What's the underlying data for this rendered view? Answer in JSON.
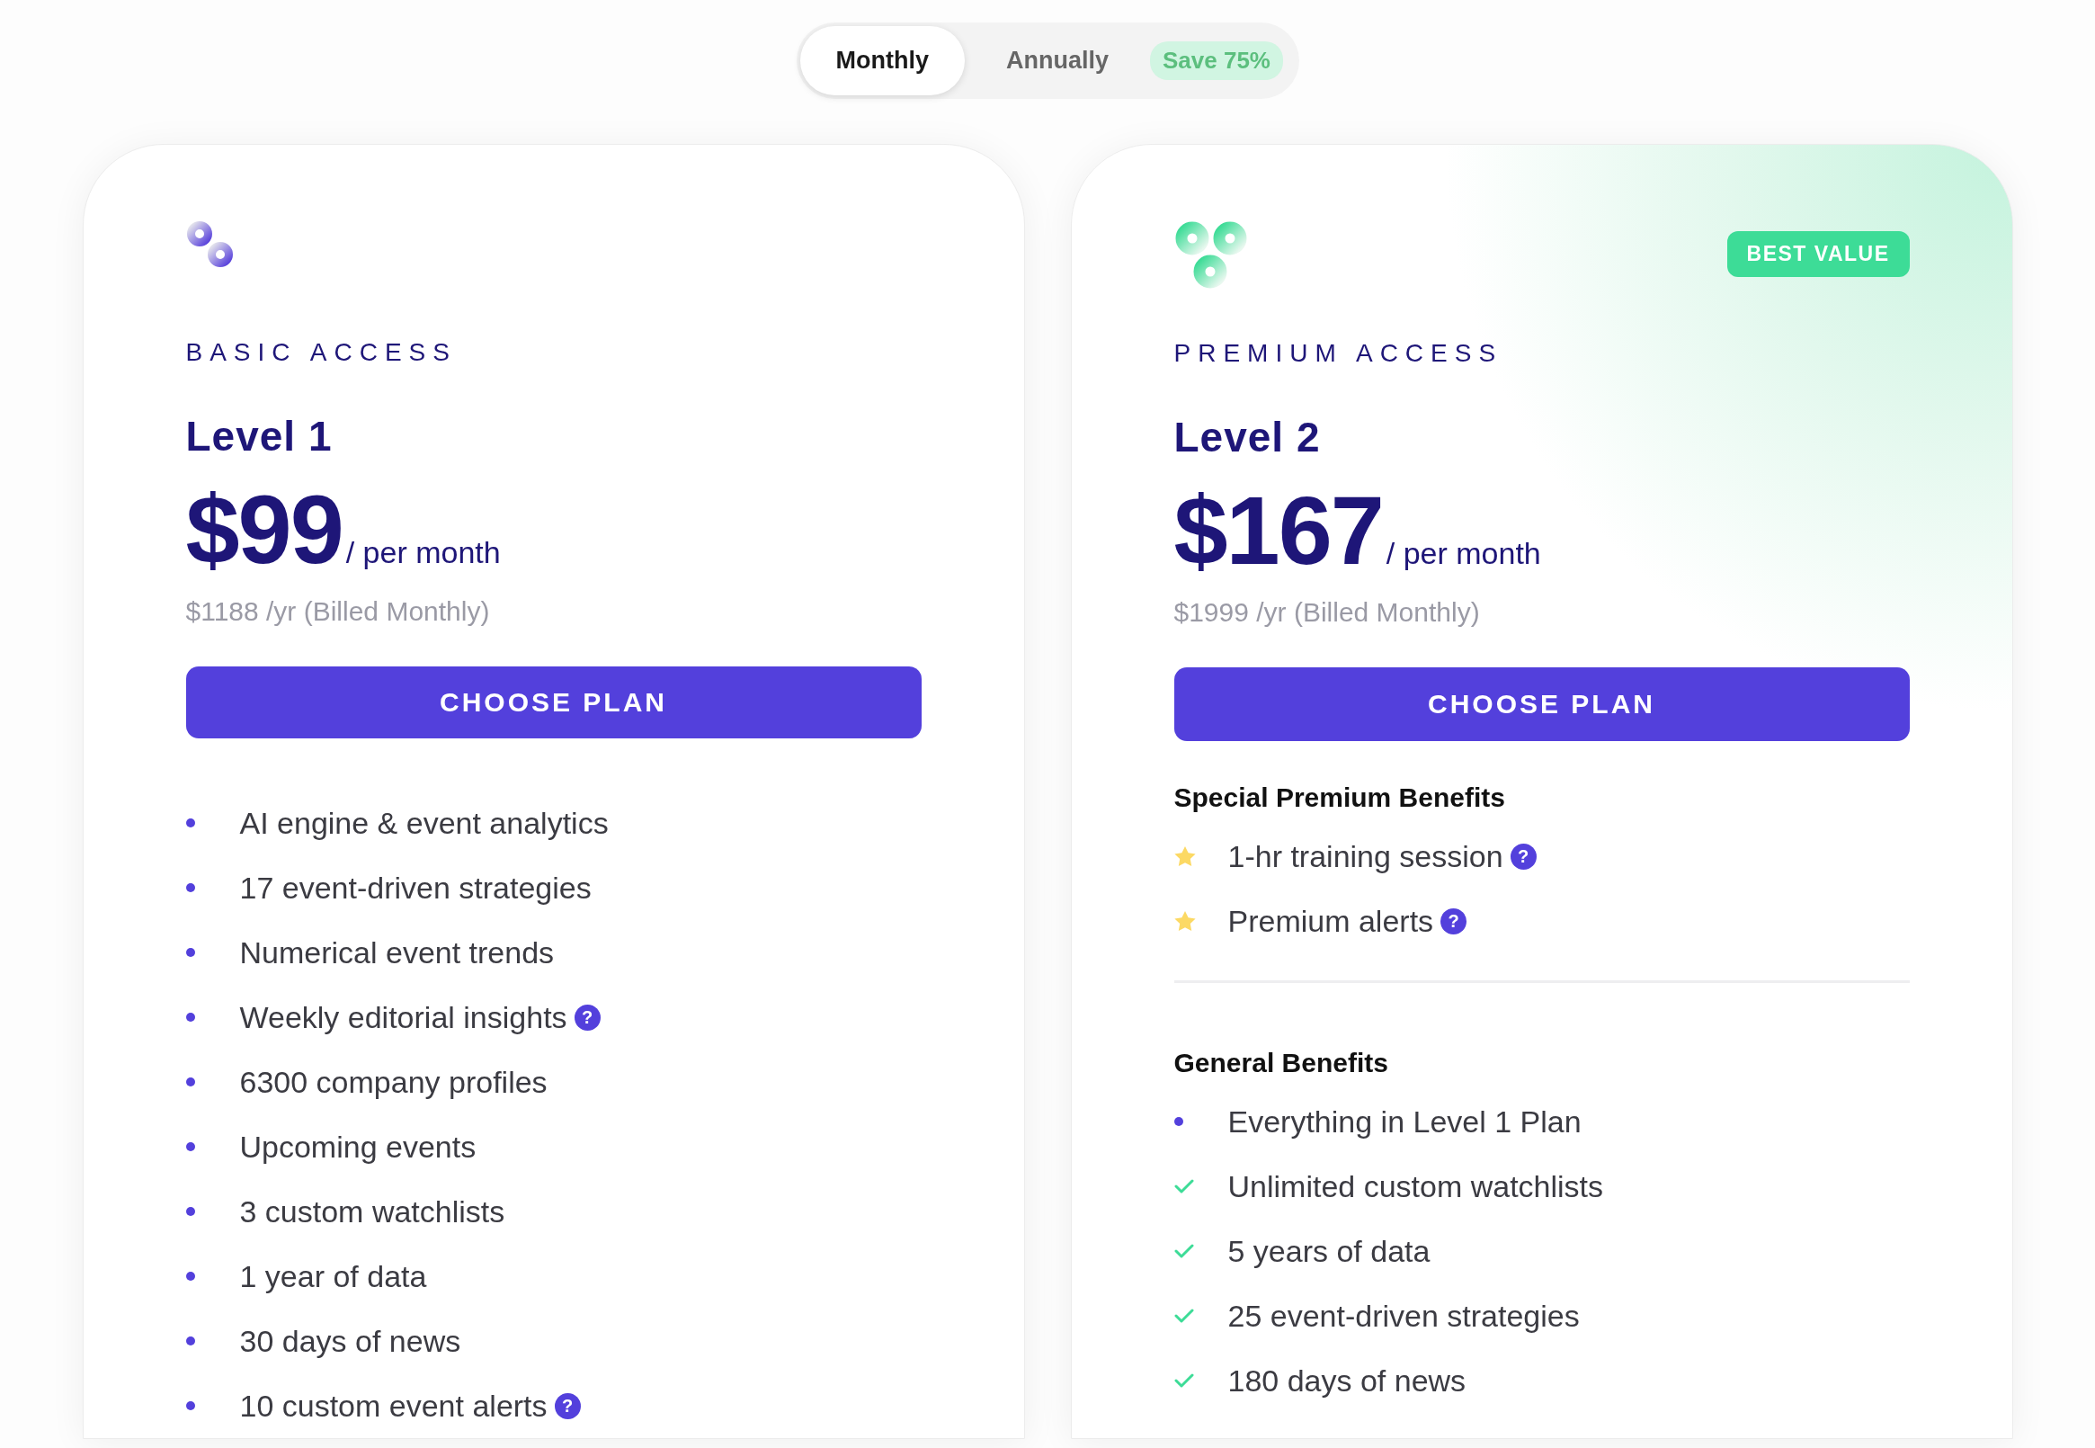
{
  "billing_toggle": {
    "options": [
      {
        "label": "Monthly",
        "selected": true
      },
      {
        "label": "Annually",
        "selected": false,
        "badge": "Save 75%"
      }
    ]
  },
  "plans": [
    {
      "kind": "basic",
      "tier": "BASIC ACCESS",
      "level": "Level 1",
      "price": "$99",
      "period": "/ per month",
      "yearly": "$1188 /yr (Billed Monthly)",
      "button": "CHOOSE PLAN",
      "sections": [
        {
          "items": [
            {
              "text": "AI engine & event analytics",
              "kind": "bullet"
            },
            {
              "text": "17 event-driven strategies",
              "kind": "bullet"
            },
            {
              "text": "Numerical event trends",
              "kind": "bullet"
            },
            {
              "text": "Weekly editorial insights",
              "kind": "bullet",
              "help": "?"
            },
            {
              "text": "6300 company profiles",
              "kind": "bullet"
            },
            {
              "text": "Upcoming events",
              "kind": "bullet"
            },
            {
              "text": "3 custom watchlists",
              "kind": "bullet"
            },
            {
              "text": "1 year of data",
              "kind": "bullet"
            },
            {
              "text": "30 days of news",
              "kind": "bullet"
            },
            {
              "text": "10 custom event alerts",
              "kind": "bullet",
              "help": "?"
            }
          ]
        }
      ]
    },
    {
      "kind": "premium",
      "badge": "BEST VALUE",
      "tier": "PREMIUM ACCESS",
      "level": "Level 2",
      "price": "$167",
      "period": "/ per month",
      "yearly": "$1999 /yr (Billed Monthly)",
      "button": "CHOOSE PLAN",
      "sections": [
        {
          "heading": "Special Premium Benefits",
          "items": [
            {
              "text": "1-hr training session",
              "kind": "star",
              "help": "?"
            },
            {
              "text": "Premium alerts",
              "kind": "star",
              "help": "?"
            }
          ]
        },
        {
          "heading": "General Benefits",
          "items": [
            {
              "text": "Everything in Level 1 Plan",
              "kind": "bullet"
            },
            {
              "text": "Unlimited custom watchlists",
              "kind": "check"
            },
            {
              "text": "5 years of data",
              "kind": "check"
            },
            {
              "text": "25 event-driven strategies",
              "kind": "check"
            },
            {
              "text": "180 days of news",
              "kind": "check"
            }
          ]
        }
      ]
    }
  ]
}
